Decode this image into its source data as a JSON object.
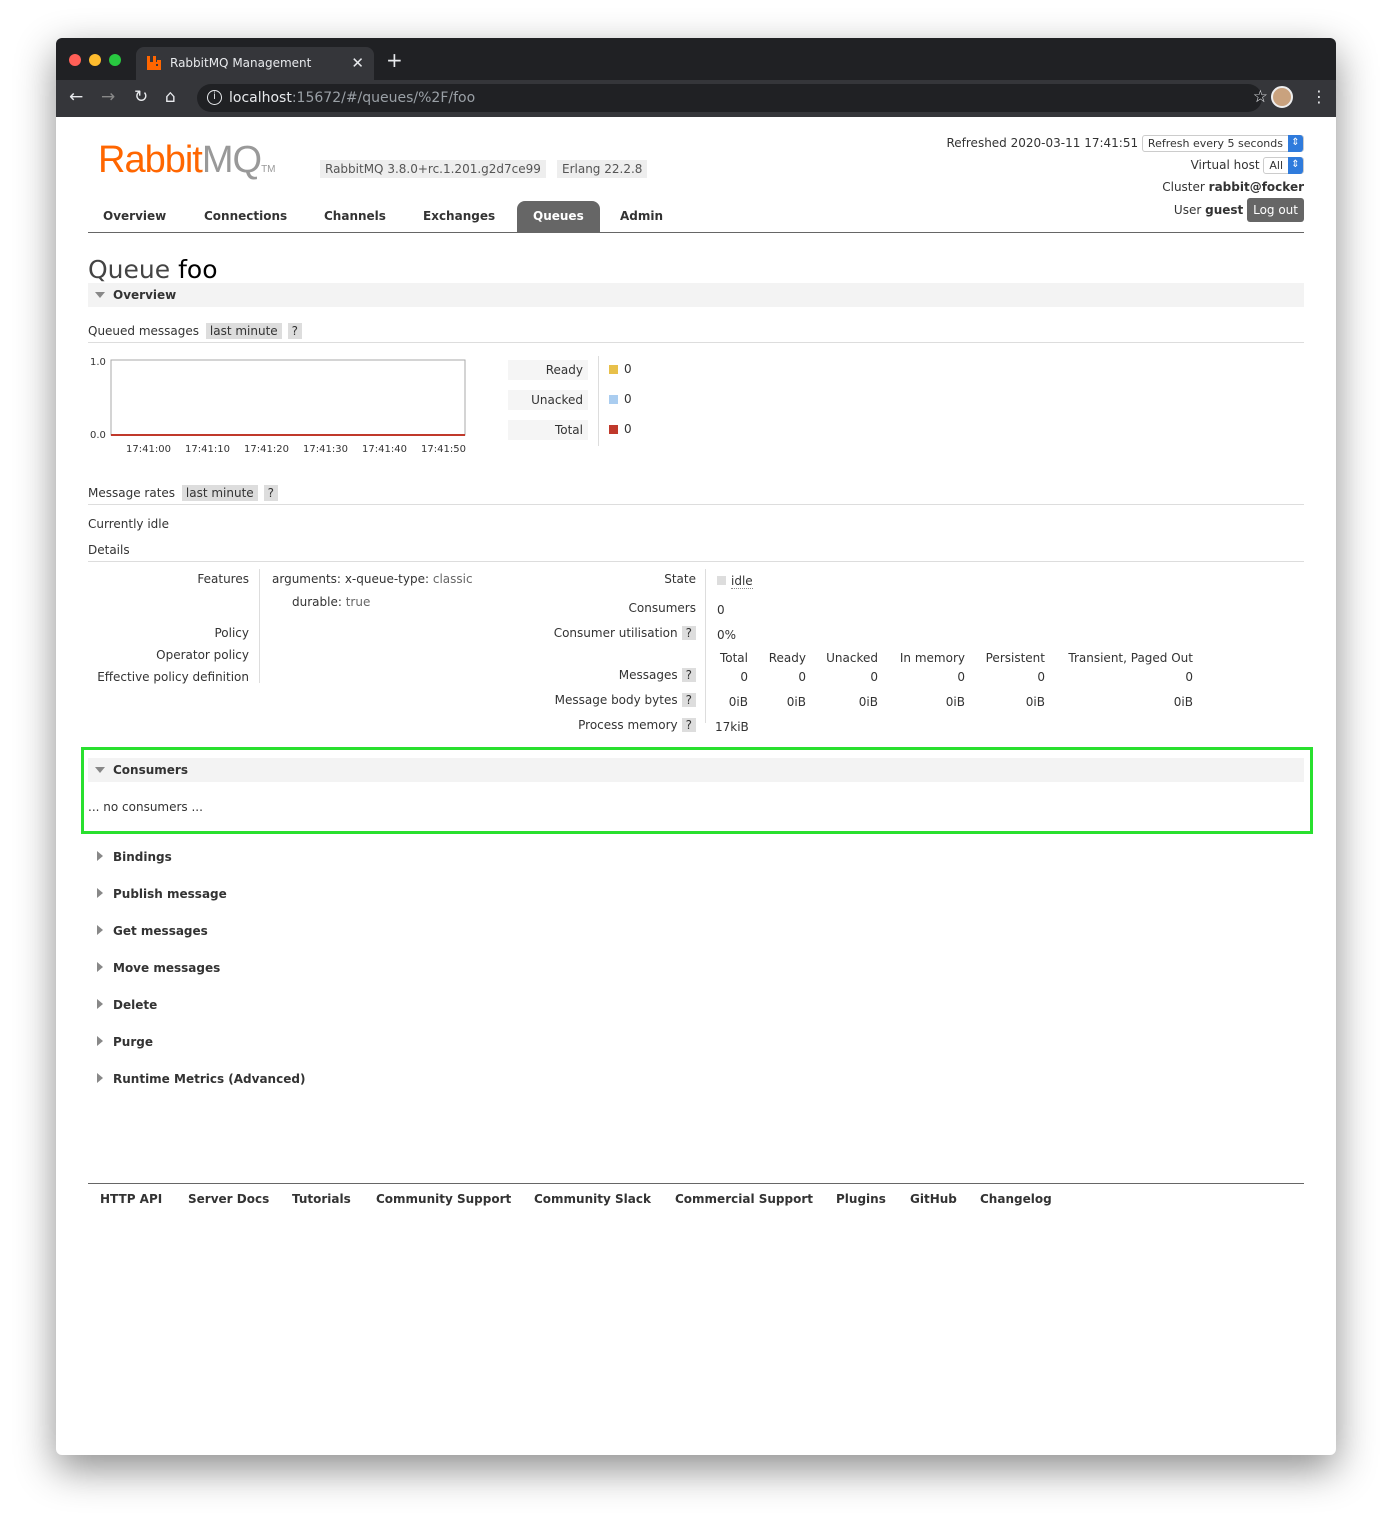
{
  "browser": {
    "tab_title": "RabbitMQ Management",
    "url_host": "localhost",
    "url_rest": ":15672/#/queues/%2F/foo"
  },
  "header": {
    "logo_main": "Rabbit",
    "logo_mq": "MQ",
    "logo_tm": "TM",
    "version": "RabbitMQ 3.8.0+rc.1.201.g2d7ce99",
    "erlang": "Erlang 22.2.8",
    "refreshed_label": "Refreshed",
    "refreshed": "2020-03-11 17:41:51",
    "refresh_select": "Refresh every 5 seconds",
    "vhost_label": "Virtual host",
    "vhost": "All",
    "cluster_label": "Cluster",
    "cluster": "rabbit@focker",
    "user_label": "User",
    "user": "guest",
    "logout": "Log out"
  },
  "nav": [
    "Overview",
    "Connections",
    "Channels",
    "Exchanges",
    "Queues",
    "Admin"
  ],
  "title_prefix": "Queue",
  "title_name": "foo",
  "overview": {
    "label": "Overview",
    "queued_label": "Queued messages",
    "last_minute": "last minute",
    "help": "?",
    "ymax": "1.0",
    "ymin": "0.0",
    "xticks": [
      "17:41:00",
      "17:41:10",
      "17:41:20",
      "17:41:30",
      "17:41:40",
      "17:41:50"
    ],
    "legend": [
      {
        "label": "Ready",
        "value": "0",
        "color": "#e8c04a"
      },
      {
        "label": "Unacked",
        "value": "0",
        "color": "#aacdf0"
      },
      {
        "label": "Total",
        "value": "0",
        "color": "#c0392b"
      }
    ],
    "rates_label": "Message rates",
    "idle": "Currently idle",
    "details": "Details"
  },
  "chart_data": {
    "type": "line",
    "x": [
      "17:41:00",
      "17:41:10",
      "17:41:20",
      "17:41:30",
      "17:41:40",
      "17:41:50"
    ],
    "ylim": [
      0,
      1
    ],
    "series": [
      {
        "name": "Ready",
        "values": [
          0,
          0,
          0,
          0,
          0,
          0
        ],
        "color": "#e8c04a"
      },
      {
        "name": "Unacked",
        "values": [
          0,
          0,
          0,
          0,
          0,
          0
        ],
        "color": "#aacdf0"
      },
      {
        "name": "Total",
        "values": [
          0,
          0,
          0,
          0,
          0,
          0
        ],
        "color": "#c0392b"
      }
    ]
  },
  "details": {
    "features_label": "Features",
    "arguments_label": "arguments:",
    "xqt_label": "x-queue-type:",
    "xqt": "classic",
    "durable_label": "durable:",
    "durable": "true",
    "policy": "Policy",
    "operator_policy": "Operator policy",
    "effective": "Effective policy definition",
    "state_label": "State",
    "state": "idle",
    "consumers_label": "Consumers",
    "consumers": "0",
    "util_label": "Consumer utilisation",
    "util": "0%",
    "cols": [
      "Total",
      "Ready",
      "Unacked",
      "In memory",
      "Persistent",
      "Transient, Paged Out"
    ],
    "messages_label": "Messages",
    "messages": [
      "0",
      "0",
      "0",
      "0",
      "0",
      "0"
    ],
    "bytes_label": "Message body bytes",
    "bytes": [
      "0iB",
      "0iB",
      "0iB",
      "0iB",
      "0iB",
      "0iB"
    ],
    "procmem_label": "Process memory",
    "procmem": "17kiB"
  },
  "consumers": {
    "label": "Consumers",
    "empty": "... no consumers ..."
  },
  "sections": [
    "Bindings",
    "Publish message",
    "Get messages",
    "Move messages",
    "Delete",
    "Purge",
    "Runtime Metrics (Advanced)"
  ],
  "footer": [
    "HTTP API",
    "Server Docs",
    "Tutorials",
    "Community Support",
    "Community Slack",
    "Commercial Support",
    "Plugins",
    "GitHub",
    "Changelog"
  ]
}
